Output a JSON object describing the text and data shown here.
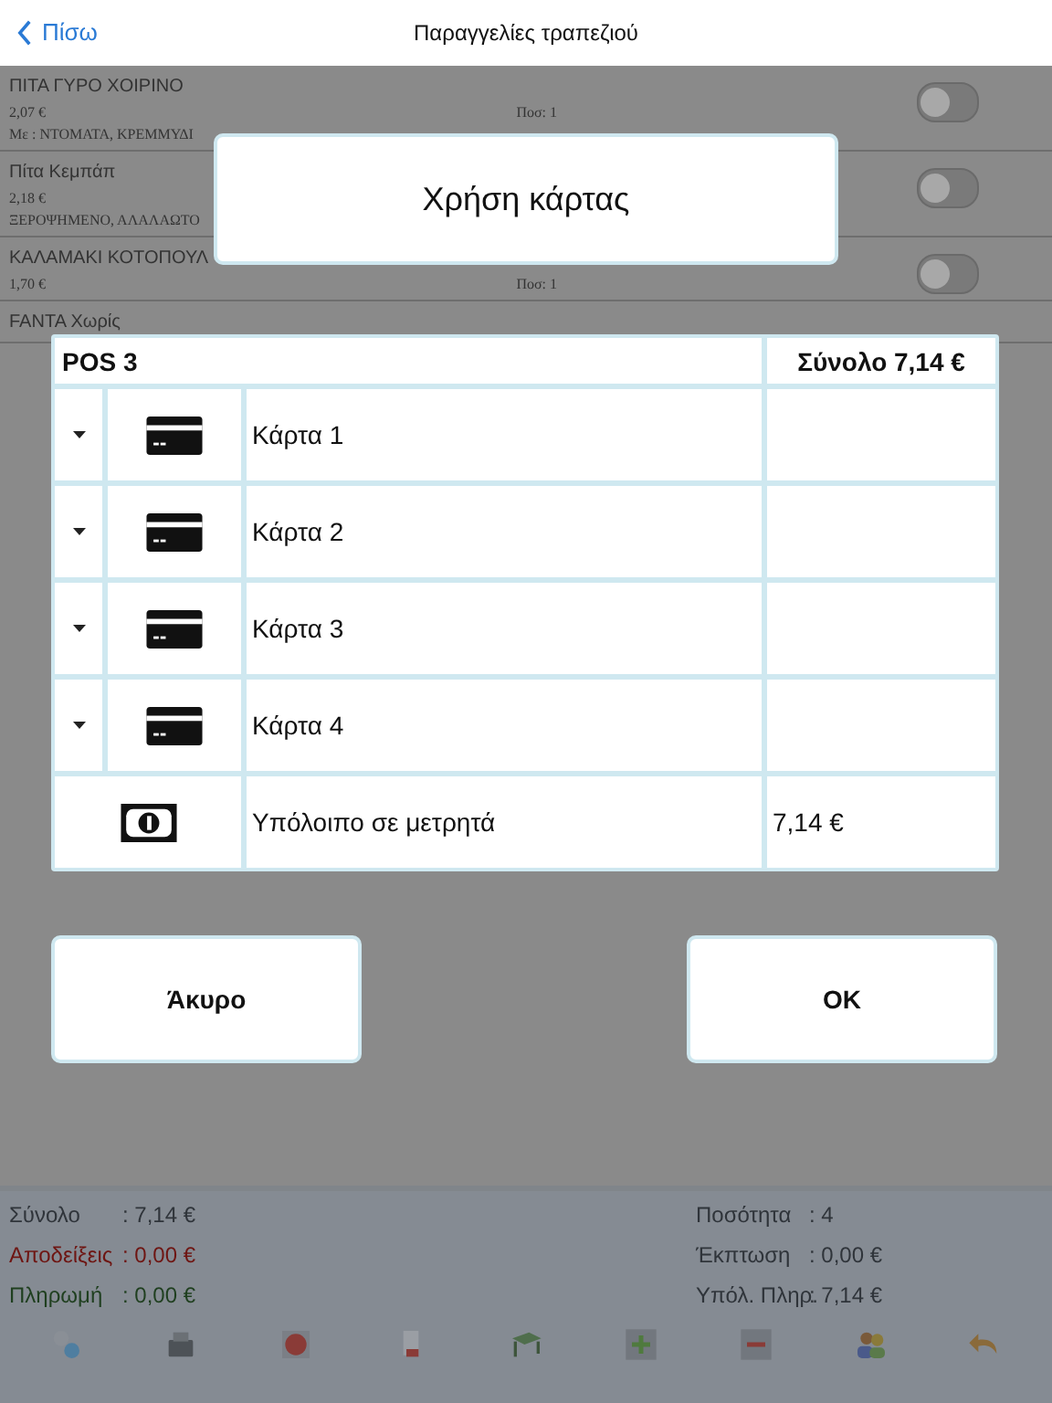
{
  "nav": {
    "back_label": "Πίσω",
    "title": "Παραγγελίες τραπεζιού"
  },
  "orders": [
    {
      "name": "ΠΙΤΑ ΓΥΡΟ ΧΟΙΡΙΝΟ",
      "price": "2,07 €",
      "qty": "Ποσ: 1",
      "note": "Με : ΝΤΟΜΑΤΑ, ΚΡΕΜΜΥΔΙ",
      "on": false
    },
    {
      "name": "Πίτα Κεμπάπ",
      "price": "2,18 €",
      "note": "ΞΕΡΟΨΗΜΕΝΟ, ΑΛΑΛΑΩΤΟ",
      "on": false
    },
    {
      "name": "ΚΑΛΑΜΑΚΙ ΚΟΤΟΠΟΥΛ",
      "price": "1,70 €",
      "qty": "Ποσ: 1",
      "on": false
    },
    {
      "name": "FANTA Χωρίς"
    }
  ],
  "summary_left": [
    {
      "label": "Σύνολο",
      "value": ": 7,14 €",
      "color": "#2f343a"
    },
    {
      "label": "Αποδείξεις",
      "value": ": 0,00 €",
      "color": "#6e1512"
    },
    {
      "label": "Πληρωμή",
      "value": ": 0,00 €",
      "color": "#1f3f1f"
    }
  ],
  "summary_right": [
    {
      "label": "Ποσότητα",
      "value": ": 4"
    },
    {
      "label": "Έκπτωση",
      "value": ": 0,00 €"
    },
    {
      "label": "Υπόλ. Πληρ.",
      "value": ": 7,14 €"
    }
  ],
  "dialog": {
    "title": "Χρήση κάρτας",
    "header": {
      "pos": "POS 3",
      "total": "Σύνολο 7,14 €"
    },
    "cards": [
      {
        "label": "Κάρτα 1"
      },
      {
        "label": "Κάρτα 2"
      },
      {
        "label": "Κάρτα 3"
      },
      {
        "label": "Κάρτα 4"
      }
    ],
    "cash": {
      "label": "Υπόλοιπο σε μετρητά",
      "amount": "7,14 €"
    },
    "buttons": [
      "Άκυρο",
      "OK"
    ]
  }
}
